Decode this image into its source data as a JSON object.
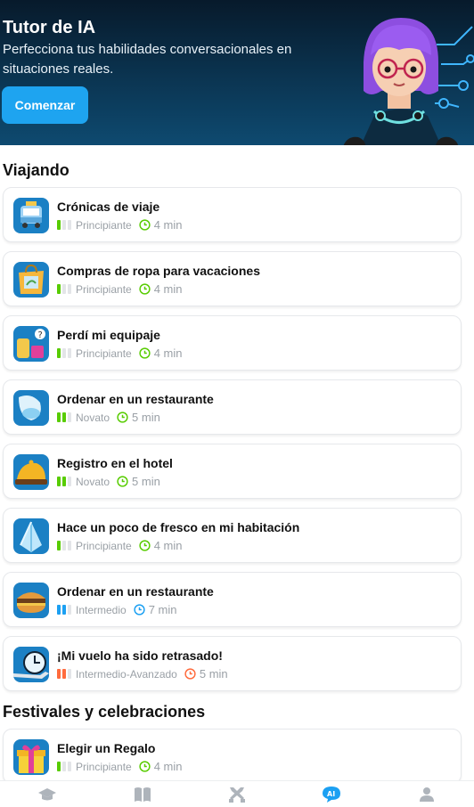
{
  "hero": {
    "title": "Tutor de IA",
    "subtitle": "Perfecciona tus habilidades conversacionales en situaciones reales.",
    "cta": "Comenzar"
  },
  "sections": [
    {
      "title": "Viajando"
    },
    {
      "title": "Festivales y celebraciones"
    }
  ],
  "lessons": [
    {
      "title": "Crónicas de viaje",
      "level": "Principiante",
      "level_bars": 1,
      "level_color": "#58cc02",
      "duration": "4 min",
      "icon": "bus-icon"
    },
    {
      "title": "Compras de ropa para vacaciones",
      "level": "Principiante",
      "level_bars": 1,
      "level_color": "#58cc02",
      "duration": "4 min",
      "icon": "shopping-bag-icon"
    },
    {
      "title": "Perdí mi equipaje",
      "level": "Principiante",
      "level_bars": 1,
      "level_color": "#58cc02",
      "duration": "4 min",
      "icon": "luggage-icon"
    },
    {
      "title": "Ordenar en un restaurante",
      "level": "Novato",
      "level_bars": 2,
      "level_color": "#58cc02",
      "duration": "5 min",
      "icon": "wine-glass-icon"
    },
    {
      "title": "Registro en el hotel",
      "level": "Novato",
      "level_bars": 2,
      "level_color": "#58cc02",
      "duration": "5 min",
      "icon": "hotel-bell-icon"
    },
    {
      "title": "Hace un poco de fresco en mi habitación",
      "level": "Principiante",
      "level_bars": 1,
      "level_color": "#58cc02",
      "duration": "4 min",
      "icon": "ice-crystal-icon"
    },
    {
      "title": "Ordenar en un restaurante",
      "level": "Intermedio",
      "level_bars": 2,
      "level_color": "#1ca0f2",
      "duration": "7 min",
      "icon": "sandwich-icon"
    },
    {
      "title": "¡Mi vuelo ha sido retrasado!",
      "level": "Intermedio-Avanzado",
      "level_bars": 2,
      "level_color": "#ff6b3d",
      "duration": "5 min",
      "icon": "airplane-clock-icon"
    },
    {
      "title": "Elegir un Regalo",
      "level": "Principiante",
      "level_bars": 1,
      "level_color": "#58cc02",
      "duration": "4 min",
      "icon": "gift-icon"
    }
  ],
  "tabbar": {
    "items": [
      "graduation-cap-icon",
      "book-icon",
      "crossed-swords-icon",
      "ai-chat-icon",
      "profile-icon"
    ],
    "active_index": 3,
    "active_color": "#1ca0f2",
    "inactive_color": "#aeb4bb"
  }
}
